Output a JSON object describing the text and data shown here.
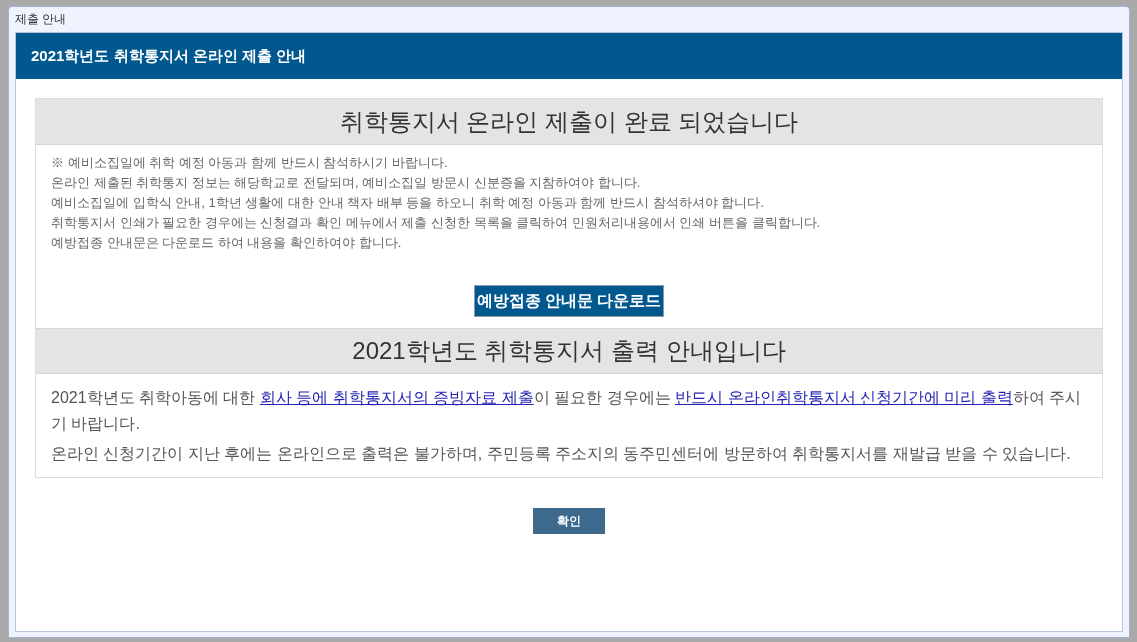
{
  "window": {
    "title": "제출 안내"
  },
  "header": {
    "title": "2021학년도 취학통지서 온라인 제출 안내"
  },
  "sections": [
    {
      "kind": "notice",
      "heading": "취학통지서 온라인 제출이 완료 되었습니다",
      "notes": [
        "※ 예비소집일에 취학 예정 아동과 함께 반드시 참석하시기 바랍니다.",
        "온라인 제출된 취학통지 정보는 해당학교로 전달되며, 예비소집일 방문시 신분증을 지참하여야 합니다.",
        "예비소집일에 입학식 안내, 1학년 생활에 대한 안내 책자 배부 등을 하오니 취학 예정 아동과 함께 반드시 참석하셔야 합니다.",
        "취학통지서 인쇄가 필요한 경우에는 신청결과 확인 메뉴에서 제출 신청한 목록을 클릭하여 민원처리내용에서 인쇄 버튼을 클릭합니다.",
        "예방접종 안내문은 다운로드 하여 내용을 확인하여야 합니다."
      ],
      "button": "예방접종 안내문 다운로드"
    },
    {
      "kind": "info",
      "heading": "2021학년도 취학통지서 출력 안내입니다",
      "paragraphs": [
        [
          {
            "kind": "text",
            "text": "2021학년도 취학아동에 대한 "
          },
          {
            "kind": "link",
            "text": "회사 등에 취학통지서의 증빙자료 제출"
          },
          {
            "kind": "text",
            "text": "이 필요한 경우에는 "
          },
          {
            "kind": "link",
            "text": "반드시 온라인취학통지서 신청기간에 미리 출력"
          },
          {
            "kind": "text",
            "text": "하여 주시기 바랍니다."
          }
        ],
        [
          {
            "kind": "text",
            "text": "온라인 신청기간이 지난 후에는 온라인으로 출력은 불가하며, 주민등록 주소지의 동주민센터에 방문하여 취학통지서를 재발급 받을 수 있습니다."
          }
        ]
      ]
    }
  ],
  "confirm_button": "확인"
}
